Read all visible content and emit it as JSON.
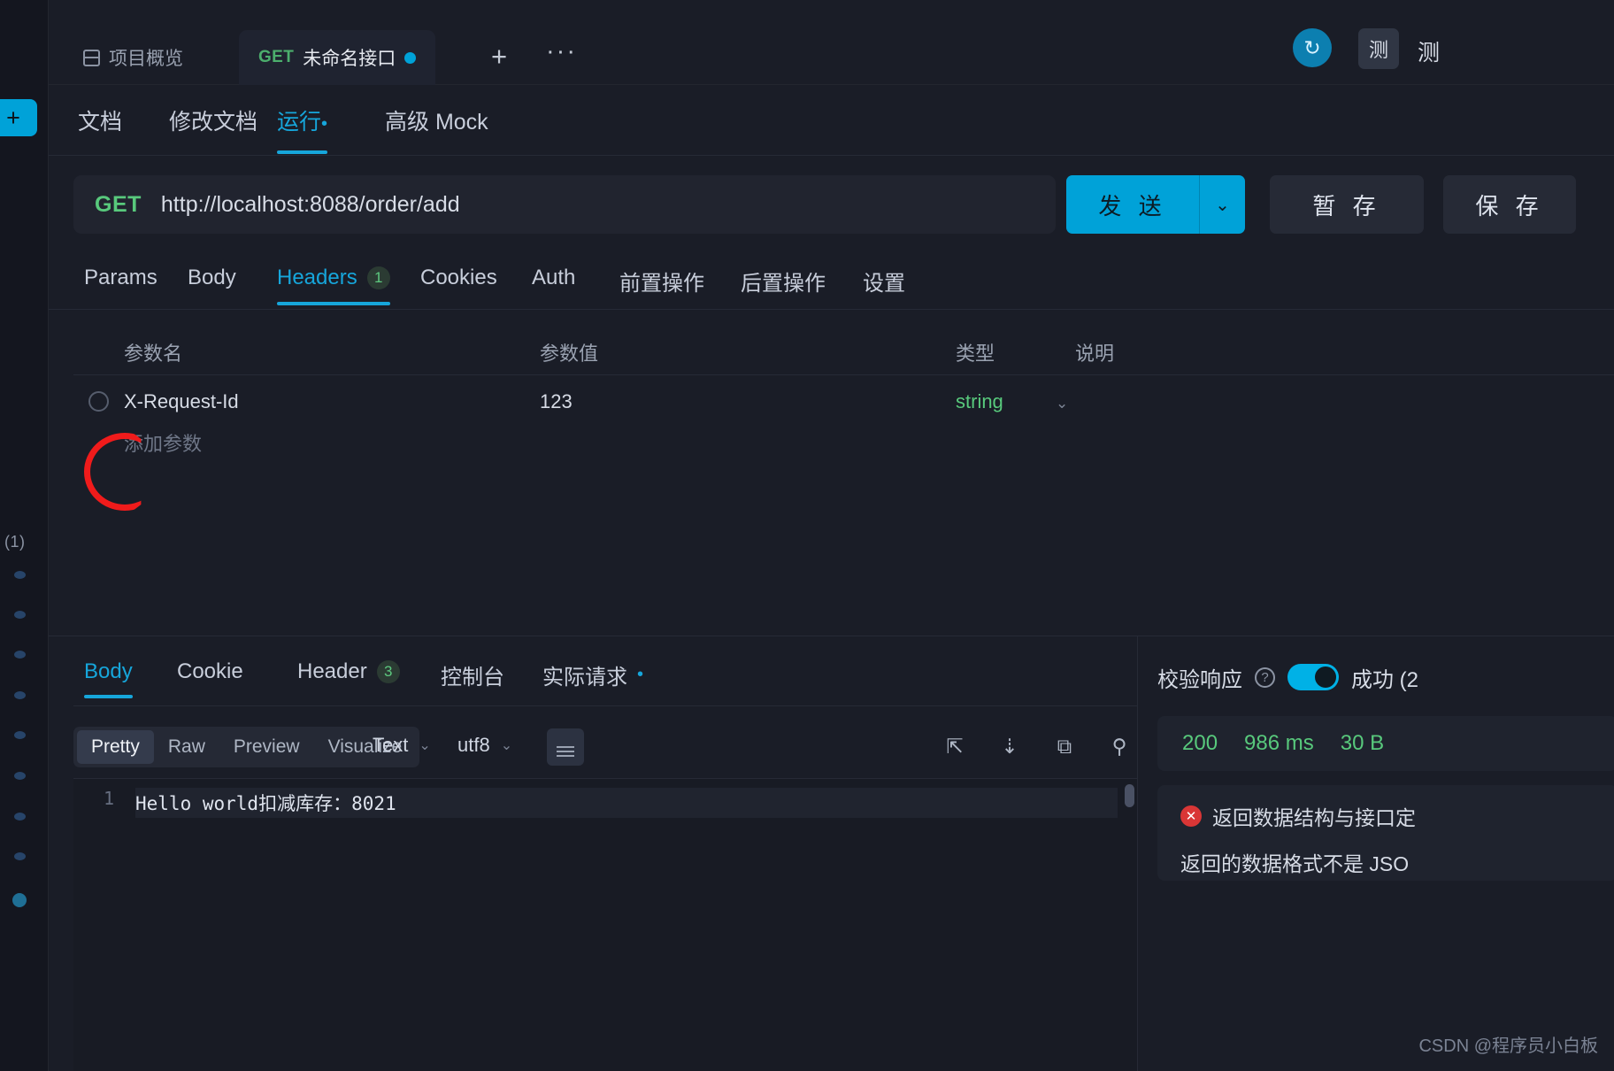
{
  "rail": {
    "add_label": "+",
    "count_label": "(1)",
    "dots": [
      "",
      "",
      "",
      "",
      "",
      "",
      ""
    ]
  },
  "tabstrip": {
    "overview_tab": "项目概览",
    "active_tab": {
      "method": "GET",
      "title": "未命名接口"
    },
    "new_tab": "+",
    "more": "···",
    "sync_icon": "sync-icon",
    "avatar_text": "测",
    "avatar_name": "测"
  },
  "topcut": {
    "left_text": "·",
    "right_text": "·"
  },
  "docnav": {
    "items": [
      {
        "label": "文档",
        "active": false
      },
      {
        "label": "修改文档",
        "active": false
      },
      {
        "label": "运行",
        "active": true,
        "dot": "•"
      },
      {
        "label": "高级 Mock",
        "active": false
      }
    ]
  },
  "urlbar": {
    "method": "GET",
    "url": "http://localhost:8088/order/add",
    "send_label": "发 送",
    "send_caret": "⌄",
    "save_label": "暂 存",
    "save2_label": "保 存"
  },
  "request_tabs": [
    {
      "label": "Params",
      "badge": null,
      "active": false
    },
    {
      "label": "Body",
      "badge": null,
      "active": false
    },
    {
      "label": "Headers",
      "badge": "1",
      "active": true
    },
    {
      "label": "Cookies",
      "badge": null,
      "active": false
    },
    {
      "label": "Auth",
      "badge": null,
      "active": false
    },
    {
      "label": "前置操作",
      "badge": null,
      "active": false
    },
    {
      "label": "后置操作",
      "badge": null,
      "active": false
    },
    {
      "label": "设置",
      "badge": null,
      "active": false
    }
  ],
  "param_table": {
    "headers": {
      "name": "参数名",
      "value": "参数值",
      "type": "类型",
      "desc": "说明"
    },
    "rows": [
      {
        "name": "X-Request-Id",
        "value": "123",
        "type": "string",
        "desc": ""
      }
    ],
    "add_row_label": "添加参数",
    "type_caret": "⌄"
  },
  "response_tabs": [
    {
      "label": "Body",
      "badge": null,
      "active": true
    },
    {
      "label": "Cookie",
      "badge": null,
      "active": false
    },
    {
      "label": "Header",
      "badge": "3",
      "active": false
    },
    {
      "label": "控制台",
      "badge": null,
      "active": false
    },
    {
      "label": "实际请求",
      "dot": "•",
      "active": false
    }
  ],
  "format_bar": {
    "segments": [
      {
        "label": "Pretty",
        "active": true
      },
      {
        "label": "Raw",
        "active": false
      },
      {
        "label": "Preview",
        "active": false
      },
      {
        "label": "Visualize",
        "active": false
      }
    ],
    "type_select": "Text",
    "encoding_select": "utf8",
    "caret": "⌄",
    "wrap_icon": "wrap-lines-icon",
    "tools": [
      "open-external-icon",
      "download-icon",
      "copy-icon",
      "search-icon"
    ]
  },
  "response_body": {
    "line_number": "1",
    "content": "Hello world扣减库存：8021"
  },
  "verify_panel": {
    "label": "校验响应",
    "help_icon": "question-mark-icon",
    "toggle_on": true,
    "state_text": "成功 (2",
    "status": {
      "code": "200",
      "time": "986 ms",
      "size": "30 B"
    },
    "error_title": "返回数据结构与接口定",
    "error_detail": "返回的数据格式不是 JSO"
  },
  "watermark": "CSDN @程序员小白板",
  "colors": {
    "accent": "#00a2d8",
    "active_tab_text": "#16a6db",
    "success_green": "#58c97c",
    "error_red": "#d93636",
    "annotation_red": "#f01b1b"
  }
}
